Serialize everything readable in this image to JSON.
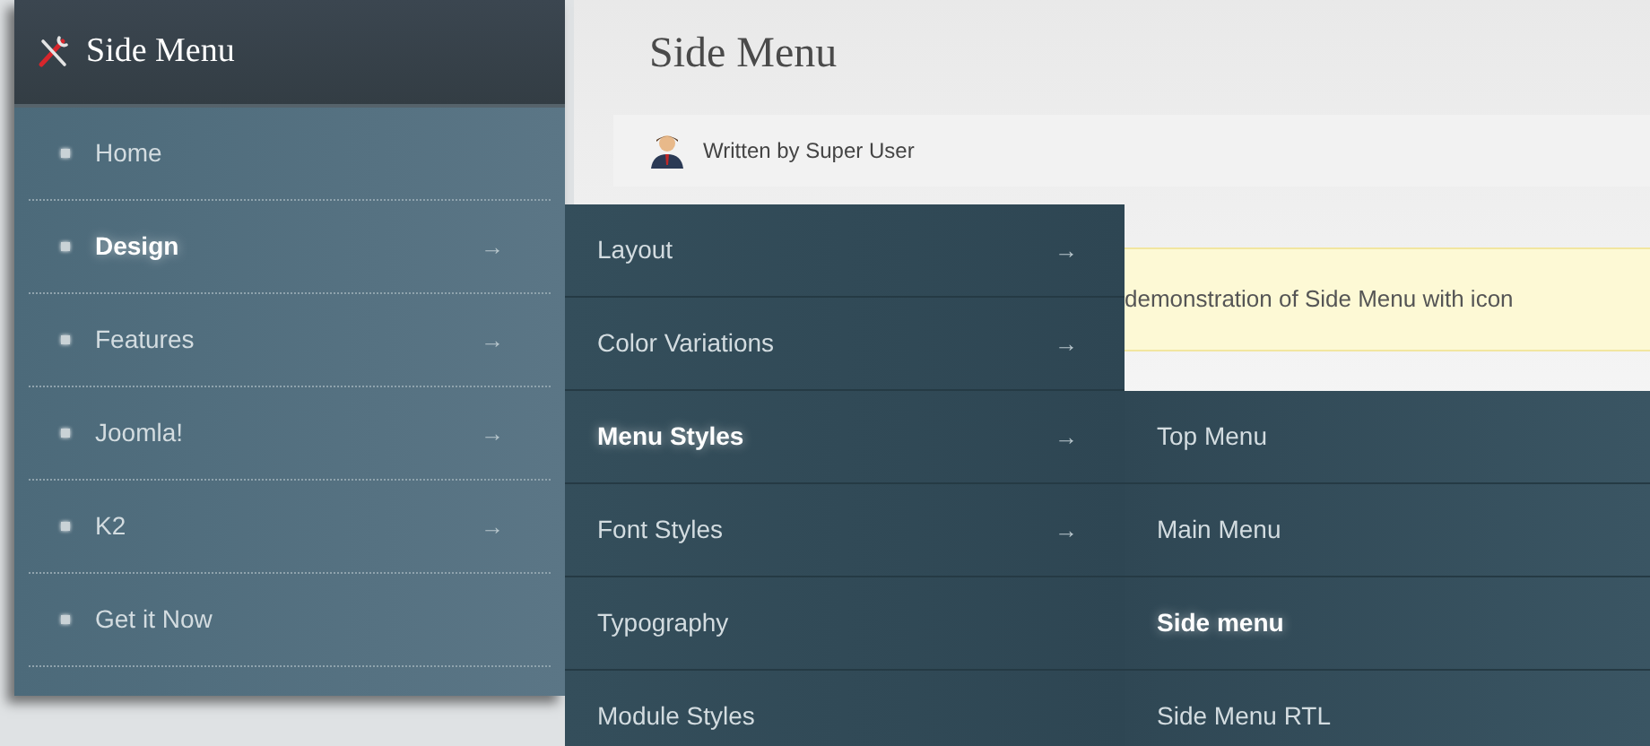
{
  "article": {
    "title": "Side Menu",
    "author": "Written by Super User",
    "notice": "demonstration of Side Menu with icon"
  },
  "side_menu": {
    "title": "Side Menu",
    "items": [
      {
        "label": "Home",
        "selected": false
      },
      {
        "label": "Design",
        "selected": true,
        "arrow": "→"
      },
      {
        "label": "Features",
        "selected": false,
        "arrow": "→"
      },
      {
        "label": "Joomla!",
        "selected": false,
        "arrow": "→"
      },
      {
        "label": "K2",
        "selected": false,
        "arrow": "→"
      },
      {
        "label": "Get it Now",
        "selected": false
      }
    ]
  },
  "submenu": {
    "items": [
      {
        "label": "Layout",
        "selected": false,
        "arrow": "→"
      },
      {
        "label": "Color Variations",
        "selected": false,
        "arrow": "→"
      },
      {
        "label": "Menu Styles",
        "selected": true,
        "arrow": "→"
      },
      {
        "label": "Font Styles",
        "selected": false,
        "arrow": "→"
      },
      {
        "label": "Typography",
        "selected": false
      },
      {
        "label": "Module Styles",
        "selected": false
      }
    ]
  },
  "submenu_2": {
    "items": [
      {
        "label": "Top Menu",
        "selected": false
      },
      {
        "label": "Main Menu",
        "selected": false
      },
      {
        "label": "Side menu",
        "selected": true
      },
      {
        "label": "Side Menu RTL",
        "selected": false
      }
    ]
  }
}
